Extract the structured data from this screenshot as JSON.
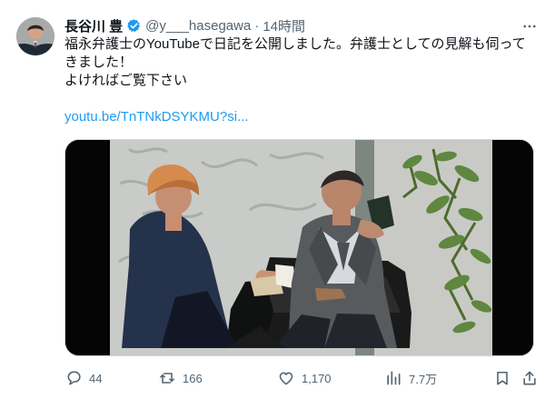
{
  "tweet": {
    "author": {
      "display_name": "長谷川 豊",
      "handle": "@y___hasegawa",
      "separator": "·",
      "time": "14時間"
    },
    "text": {
      "line1": "福永弁護士のYouTubeで日記を公開しました。弁護士としての見解も伺って",
      "line2": "きました！",
      "line3": "よければご覧下さい"
    },
    "link": "youtu.be/TnTNkDSYKMU?si...",
    "metrics": {
      "replies": "44",
      "reposts": "166",
      "likes": "1,170",
      "views": "7.7万"
    }
  },
  "icons": {
    "verified": "verified-check-icon",
    "more": "more-icon",
    "reply": "reply-icon",
    "repost": "repost-icon",
    "like": "heart-icon",
    "views": "views-bar-chart-icon",
    "bookmark": "bookmark-icon",
    "share": "share-icon"
  },
  "colors": {
    "text": "#0f1419",
    "secondary": "#536471",
    "link": "#1d9bf0"
  }
}
